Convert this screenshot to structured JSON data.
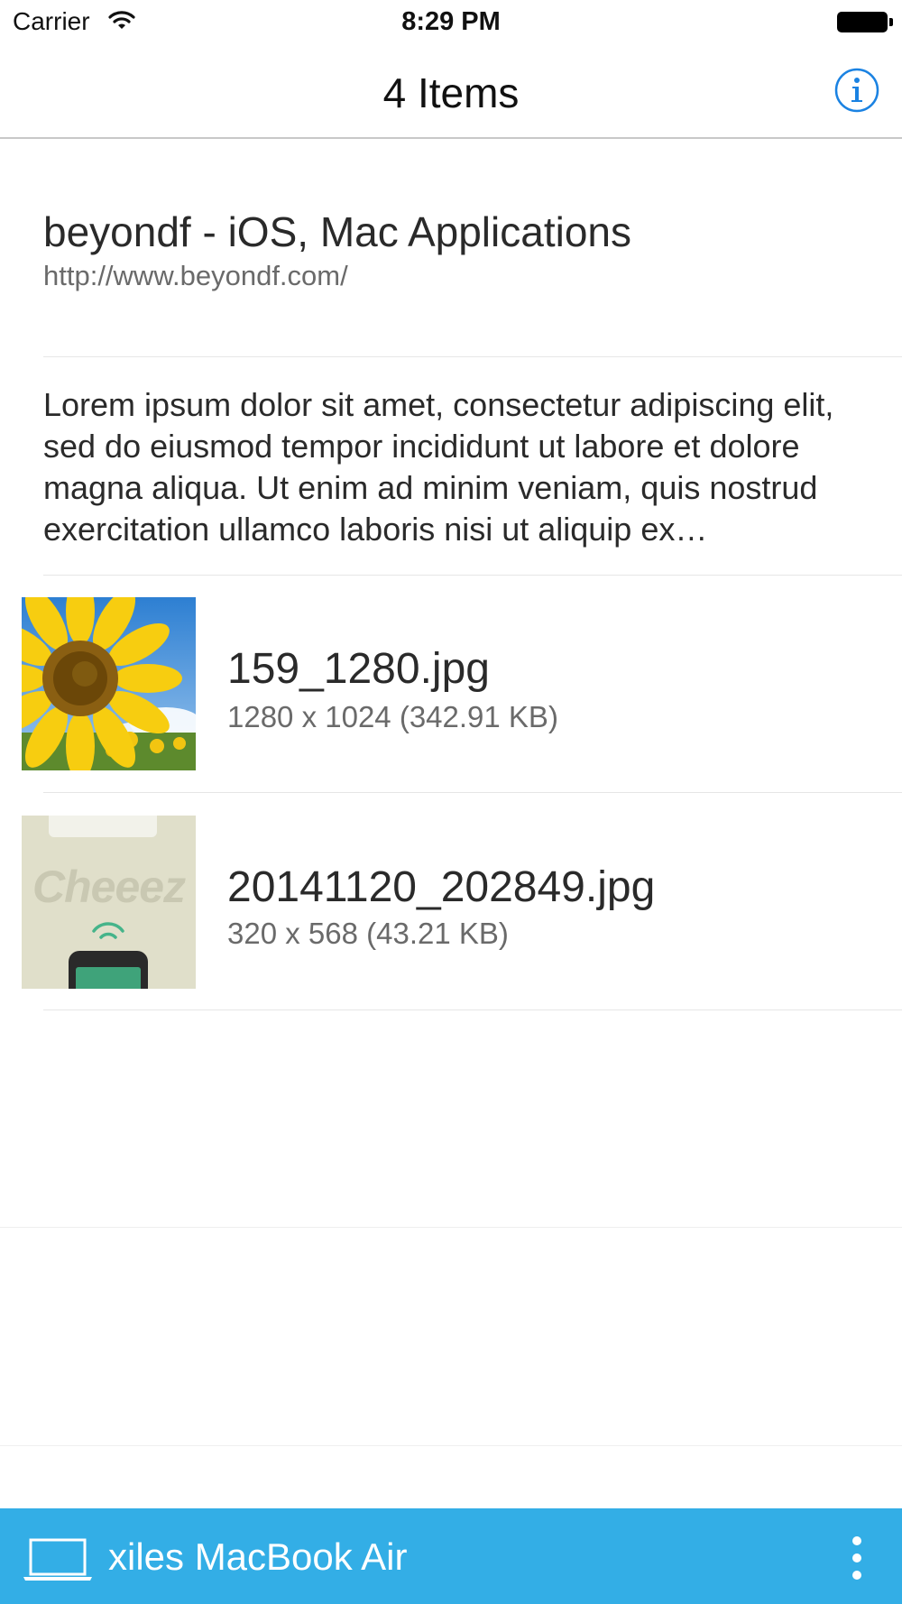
{
  "status_bar": {
    "carrier": "Carrier",
    "time": "8:29 PM"
  },
  "nav": {
    "title": "4 Items",
    "info_icon": "info-circle-icon"
  },
  "items": {
    "link": {
      "title": "beyondf - iOS, Mac Applications",
      "url": "http://www.beyondf.com/"
    },
    "text": {
      "body": "Lorem ipsum dolor sit amet, consectetur adipiscing elit, sed do eiusmod tempor incididunt ut labore et dolore magna aliqua. Ut enim ad minim veniam, quis nostrud exercitation ullamco laboris nisi ut aliquip ex…"
    },
    "image1": {
      "name": "159_1280.jpg",
      "meta": "1280 x 1024 (342.91 KB)"
    },
    "image2": {
      "name": "20141120_202849.jpg",
      "meta": "320 x 568 (43.21 KB)",
      "thumb_text": "Cheeez"
    }
  },
  "bottom_bar": {
    "device_name": "xiles MacBook Air",
    "device_icon": "laptop-icon",
    "menu_icon": "more-vertical-icon"
  },
  "colors": {
    "accent": "#1a82e2",
    "bottom_bar": "#33aee6",
    "separator": "#e6e6e6"
  }
}
